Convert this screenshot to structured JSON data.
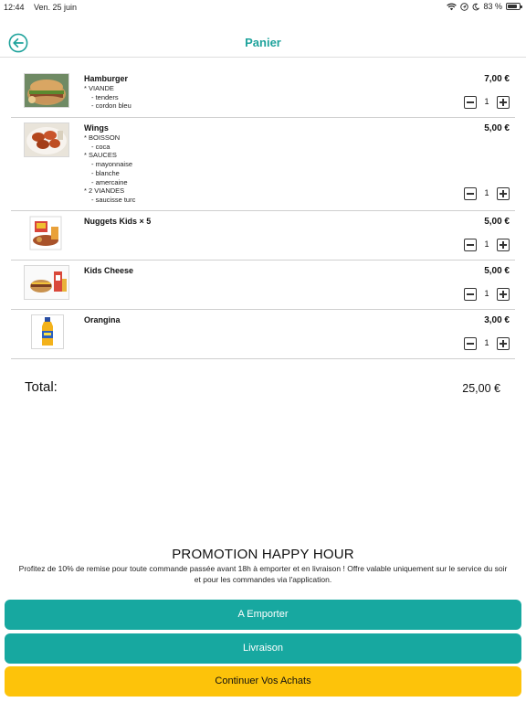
{
  "status_bar": {
    "time": "12:44",
    "date": "Ven. 25 juin",
    "battery": "83 %",
    "battery_level": 0.83,
    "icons": [
      "wifi-icon",
      "location-icon",
      "moon-icon",
      "battery-icon"
    ]
  },
  "nav": {
    "title": "Panier",
    "back_icon": "back-arrow-circle-icon"
  },
  "items": [
    {
      "name": "Hamburger",
      "price": "7,00 €",
      "quantity": "1",
      "options": [
        {
          "text": "* VIANDE",
          "sub": false
        },
        {
          "text": "- tenders",
          "sub": true
        },
        {
          "text": "- cordon bleu",
          "sub": true
        }
      ]
    },
    {
      "name": "Wings",
      "price": "5,00 €",
      "quantity": "1",
      "options": [
        {
          "text": "* BOISSON",
          "sub": false
        },
        {
          "text": "- coca",
          "sub": true
        },
        {
          "text": "* SAUCES",
          "sub": false
        },
        {
          "text": "- mayonnaise",
          "sub": true
        },
        {
          "text": "- blanche",
          "sub": true
        },
        {
          "text": "- amercaine",
          "sub": true
        },
        {
          "text": "* 2 VIANDES",
          "sub": false
        },
        {
          "text": "- saucisse turc",
          "sub": true
        }
      ]
    },
    {
      "name": "Nuggets Kids × 5",
      "price": "5,00 €",
      "quantity": "1",
      "options": []
    },
    {
      "name": "Kids Cheese",
      "price": "5,00 €",
      "quantity": "1",
      "options": []
    },
    {
      "name": "Orangina",
      "price": "3,00 €",
      "quantity": "1",
      "options": []
    }
  ],
  "total": {
    "label": "Total:",
    "value": "25,00 €"
  },
  "promo": {
    "title": "PROMOTION HAPPY HOUR",
    "text": "Profitez de 10% de remise pour toute commande passée avant 18h à emporter et en livraison ! Offre valable uniquement sur le service du soir et pour les commandes via l'application."
  },
  "actions": {
    "takeaway": "A Emporter",
    "delivery": "Livraison",
    "continue": "Continuer Vos Achats"
  },
  "colors": {
    "accent": "#1fa39c",
    "button_teal": "#17a8a0",
    "button_yellow": "#fdc30a"
  }
}
